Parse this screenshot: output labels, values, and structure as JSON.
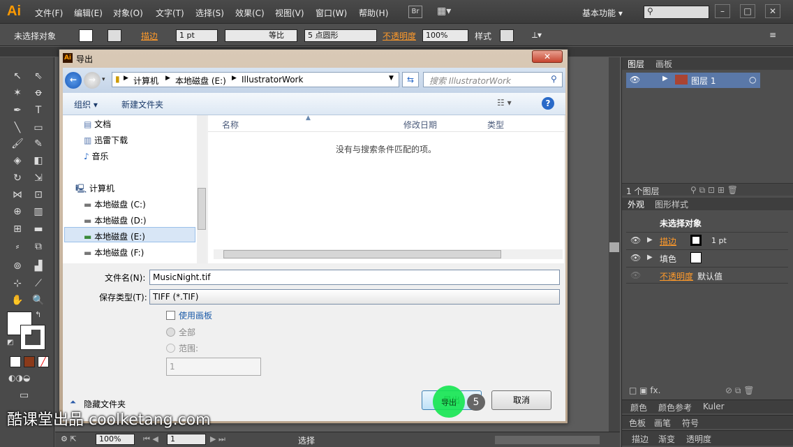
{
  "app": {
    "logo": "Ai",
    "menu": [
      "文件(F)",
      "编辑(E)",
      "对象(O)",
      "文字(T)",
      "选择(S)",
      "效果(C)",
      "视图(V)",
      "窗口(W)",
      "帮助(H)"
    ],
    "bridge_label": "Br",
    "workspace": "基本功能",
    "window_buttons": [
      "–",
      "□",
      "✕"
    ]
  },
  "controlbar": {
    "selection": "未选择对象",
    "stroke_label": "描边",
    "stroke_value": "1 pt",
    "profile": "等比",
    "brush": "5 点圆形",
    "opacity_label": "不透明度",
    "opacity_value": "100%",
    "style_label": "样式"
  },
  "status": {
    "zoom": "100%",
    "page": "1",
    "tool": "选择"
  },
  "layers_panel": {
    "tabs": [
      "图层",
      "画板"
    ],
    "layer_name": "图层 1",
    "count": "1 个图层"
  },
  "appearance_panel": {
    "tabs": [
      "外观",
      "图形样式"
    ],
    "title": "未选择对象",
    "rows": [
      {
        "label": "描边",
        "value": "1 pt"
      },
      {
        "label": "填色",
        "value": ""
      },
      {
        "label": "不透明度",
        "value": "默认值"
      }
    ],
    "fx": "fx."
  },
  "bottom_panels": {
    "row1": [
      "颜色",
      "颜色参考",
      "Kuler"
    ],
    "row2": [
      "色板",
      "画笔",
      "符号"
    ],
    "row3": [
      "描边",
      "渐变",
      "透明度"
    ]
  },
  "dialog": {
    "title": "导出",
    "close": "✕",
    "path": [
      "计算机",
      "本地磁盘 (E:)",
      "IllustratorWork"
    ],
    "search_placeholder": "搜索 IllustratorWork",
    "organize": "组织 ▾",
    "new_folder": "新建文件夹",
    "nav_items": [
      "文档",
      "迅雷下载",
      "音乐"
    ],
    "computer": "计算机",
    "drives": [
      "本地磁盘 (C:)",
      "本地磁盘 (D:)",
      "本地磁盘 (E:)",
      "本地磁盘 (F:)"
    ],
    "columns": [
      "名称",
      "修改日期",
      "类型"
    ],
    "empty_message": "没有与搜索条件匹配的项。",
    "filename_label": "文件名(N):",
    "filename_value": "MusicNight.tif",
    "filetype_label": "保存类型(T):",
    "filetype_value": "TIFF (*.TIF)",
    "use_artboards": "使用画板",
    "all_label": "全部",
    "range_label": "范围:",
    "range_value": "1",
    "hide_folders": "隐藏文件夹",
    "export_button": "导出",
    "cancel_button": "取消"
  },
  "overlay": {
    "step": "5",
    "watermark": "酷课堂出品 coolketang.com"
  },
  "colors": {
    "accent_orange": "#ff9a2a",
    "highlight_green": "#14e650"
  }
}
